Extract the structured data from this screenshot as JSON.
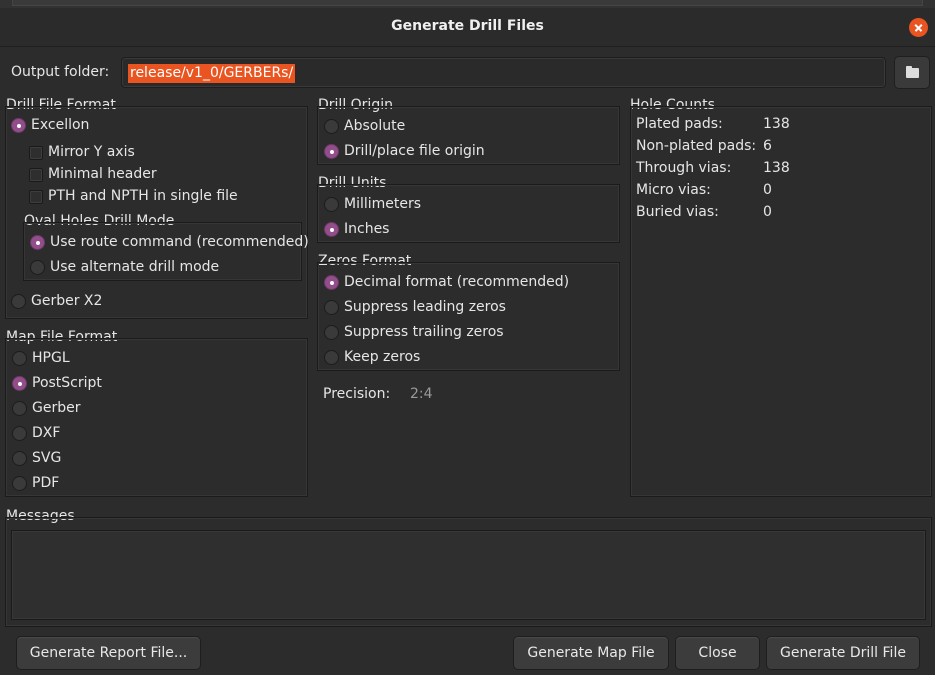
{
  "window": {
    "title": "Generate Drill Files"
  },
  "output": {
    "label": "Output folder:",
    "value": "release/v1_0/GERBERs/"
  },
  "drill_file_format": {
    "title": "Drill File Format",
    "excellon": {
      "label": "Excellon",
      "selected": true
    },
    "mirror_y": {
      "label": "Mirror Y axis",
      "checked": false
    },
    "minimal_header": {
      "label": "Minimal header",
      "checked": false
    },
    "pth_npth_single": {
      "label": "PTH and NPTH in single file",
      "checked": false
    },
    "oval": {
      "title": "Oval Holes Drill Mode",
      "route": {
        "label": "Use route command (recommended)",
        "selected": true
      },
      "alternate": {
        "label": "Use alternate drill mode",
        "selected": false
      }
    },
    "gerber_x2": {
      "label": "Gerber X2",
      "selected": false
    }
  },
  "map_file_format": {
    "title": "Map File Format",
    "options": [
      {
        "label": "HPGL",
        "selected": false
      },
      {
        "label": "PostScript",
        "selected": true
      },
      {
        "label": "Gerber",
        "selected": false
      },
      {
        "label": "DXF",
        "selected": false
      },
      {
        "label": "SVG",
        "selected": false
      },
      {
        "label": "PDF",
        "selected": false
      }
    ]
  },
  "drill_origin": {
    "title": "Drill Origin",
    "options": [
      {
        "label": "Absolute",
        "selected": false
      },
      {
        "label": "Drill/place file origin",
        "selected": true
      }
    ]
  },
  "drill_units": {
    "title": "Drill Units",
    "options": [
      {
        "label": "Millimeters",
        "selected": false
      },
      {
        "label": "Inches",
        "selected": true
      }
    ]
  },
  "zeros_format": {
    "title": "Zeros Format",
    "options": [
      {
        "label": "Decimal format (recommended)",
        "selected": true
      },
      {
        "label": "Suppress leading zeros",
        "selected": false
      },
      {
        "label": "Suppress trailing zeros",
        "selected": false
      },
      {
        "label": "Keep zeros",
        "selected": false
      }
    ]
  },
  "precision": {
    "label": "Precision:",
    "value": "2:4"
  },
  "hole_counts": {
    "title": "Hole Counts",
    "rows": [
      {
        "label": "Plated pads:",
        "value": "138"
      },
      {
        "label": "Non-plated pads:",
        "value": "6"
      },
      {
        "label": "Through vias:",
        "value": "138"
      },
      {
        "label": "Micro vias:",
        "value": "0"
      },
      {
        "label": "Buried vias:",
        "value": "0"
      }
    ]
  },
  "messages": {
    "title": "Messages"
  },
  "buttons": {
    "report": "Generate Report File...",
    "map": "Generate Map File",
    "close": "Close",
    "drill": "Generate Drill File"
  },
  "colors": {
    "accent": "#e95420",
    "radio_selected": "#924d8b",
    "background": "#2c2c2c"
  }
}
